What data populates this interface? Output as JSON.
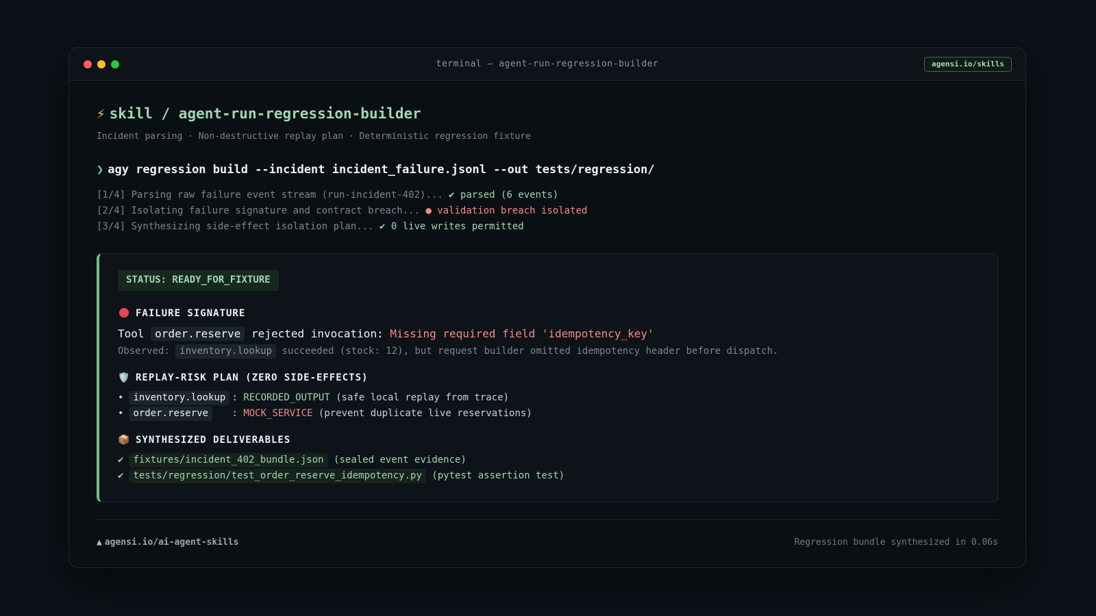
{
  "window": {
    "title": "terminal — agent-run-regression-builder",
    "badge": "agensi.io/skills"
  },
  "header": {
    "bolt": "⚡",
    "title": "skill / agent-run-regression-builder",
    "subtitle": "Incident parsing · Non-destructive replay plan · Deterministic regression fixture"
  },
  "command": {
    "prompt": "❯",
    "text": "agy regression build --incident incident_failure.jsonl --out tests/regression/"
  },
  "logs": [
    {
      "text": "[1/4] Parsing raw failure event stream (run-incident-402)... ",
      "result": "✔ parsed (6 events)"
    },
    {
      "text": "[2/4] Isolating failure signature and contract breach... ",
      "result": "● validation breach isolated"
    },
    {
      "text": "[3/4] Synthesizing side-effect isolation plan... ",
      "result": "✔ 0 live writes permitted"
    }
  ],
  "panel": {
    "status": "STATUS: READY_FOR_FIXTURE",
    "failure": {
      "title": "FAILURE SIGNATURE",
      "tool_prefix": "Tool",
      "tool_name": "order.reserve",
      "tool_mid": "rejected invocation:",
      "error": "Missing required field 'idempotency_key'",
      "observed_label": "Observed:",
      "observed_code": "inventory.lookup",
      "observed_text": "succeeded (stock: 12), but request builder omitted idempotency header before dispatch."
    },
    "replay": {
      "icon": "🛡️",
      "title": "REPLAY-RISK PLAN (ZERO SIDE-EFFECTS)",
      "items": [
        {
          "bullet": "•",
          "tool": "inventory.lookup",
          "sep": ":",
          "mode": "RECORDED_OUTPUT",
          "note": "(safe local replay from trace)"
        },
        {
          "bullet": "•",
          "tool": "order.reserve",
          "sep": ":",
          "mode": "MOCK_SERVICE",
          "note": "(prevent duplicate live reservations)"
        }
      ]
    },
    "deliverables": {
      "icon": "📦",
      "title": "SYNTHESIZED DELIVERABLES",
      "items": [
        {
          "check": "✔",
          "path": "fixtures/incident_402_bundle.json",
          "note": "(sealed event evidence)"
        },
        {
          "check": "✔",
          "path": "tests/regression/test_order_reserve_idempotency.py",
          "note": "(pytest assertion test)"
        }
      ]
    }
  },
  "footer": {
    "tri": "▲",
    "link": "agensi.io/ai-agent-skills",
    "summary": "Regression bundle synthesized in 0.06s"
  },
  "colors": {
    "accent_green": "#9fd7b1",
    "error_red": "#f48a8a",
    "mode_green": "#9fd7b1",
    "mode_red": "#f48a8a"
  }
}
